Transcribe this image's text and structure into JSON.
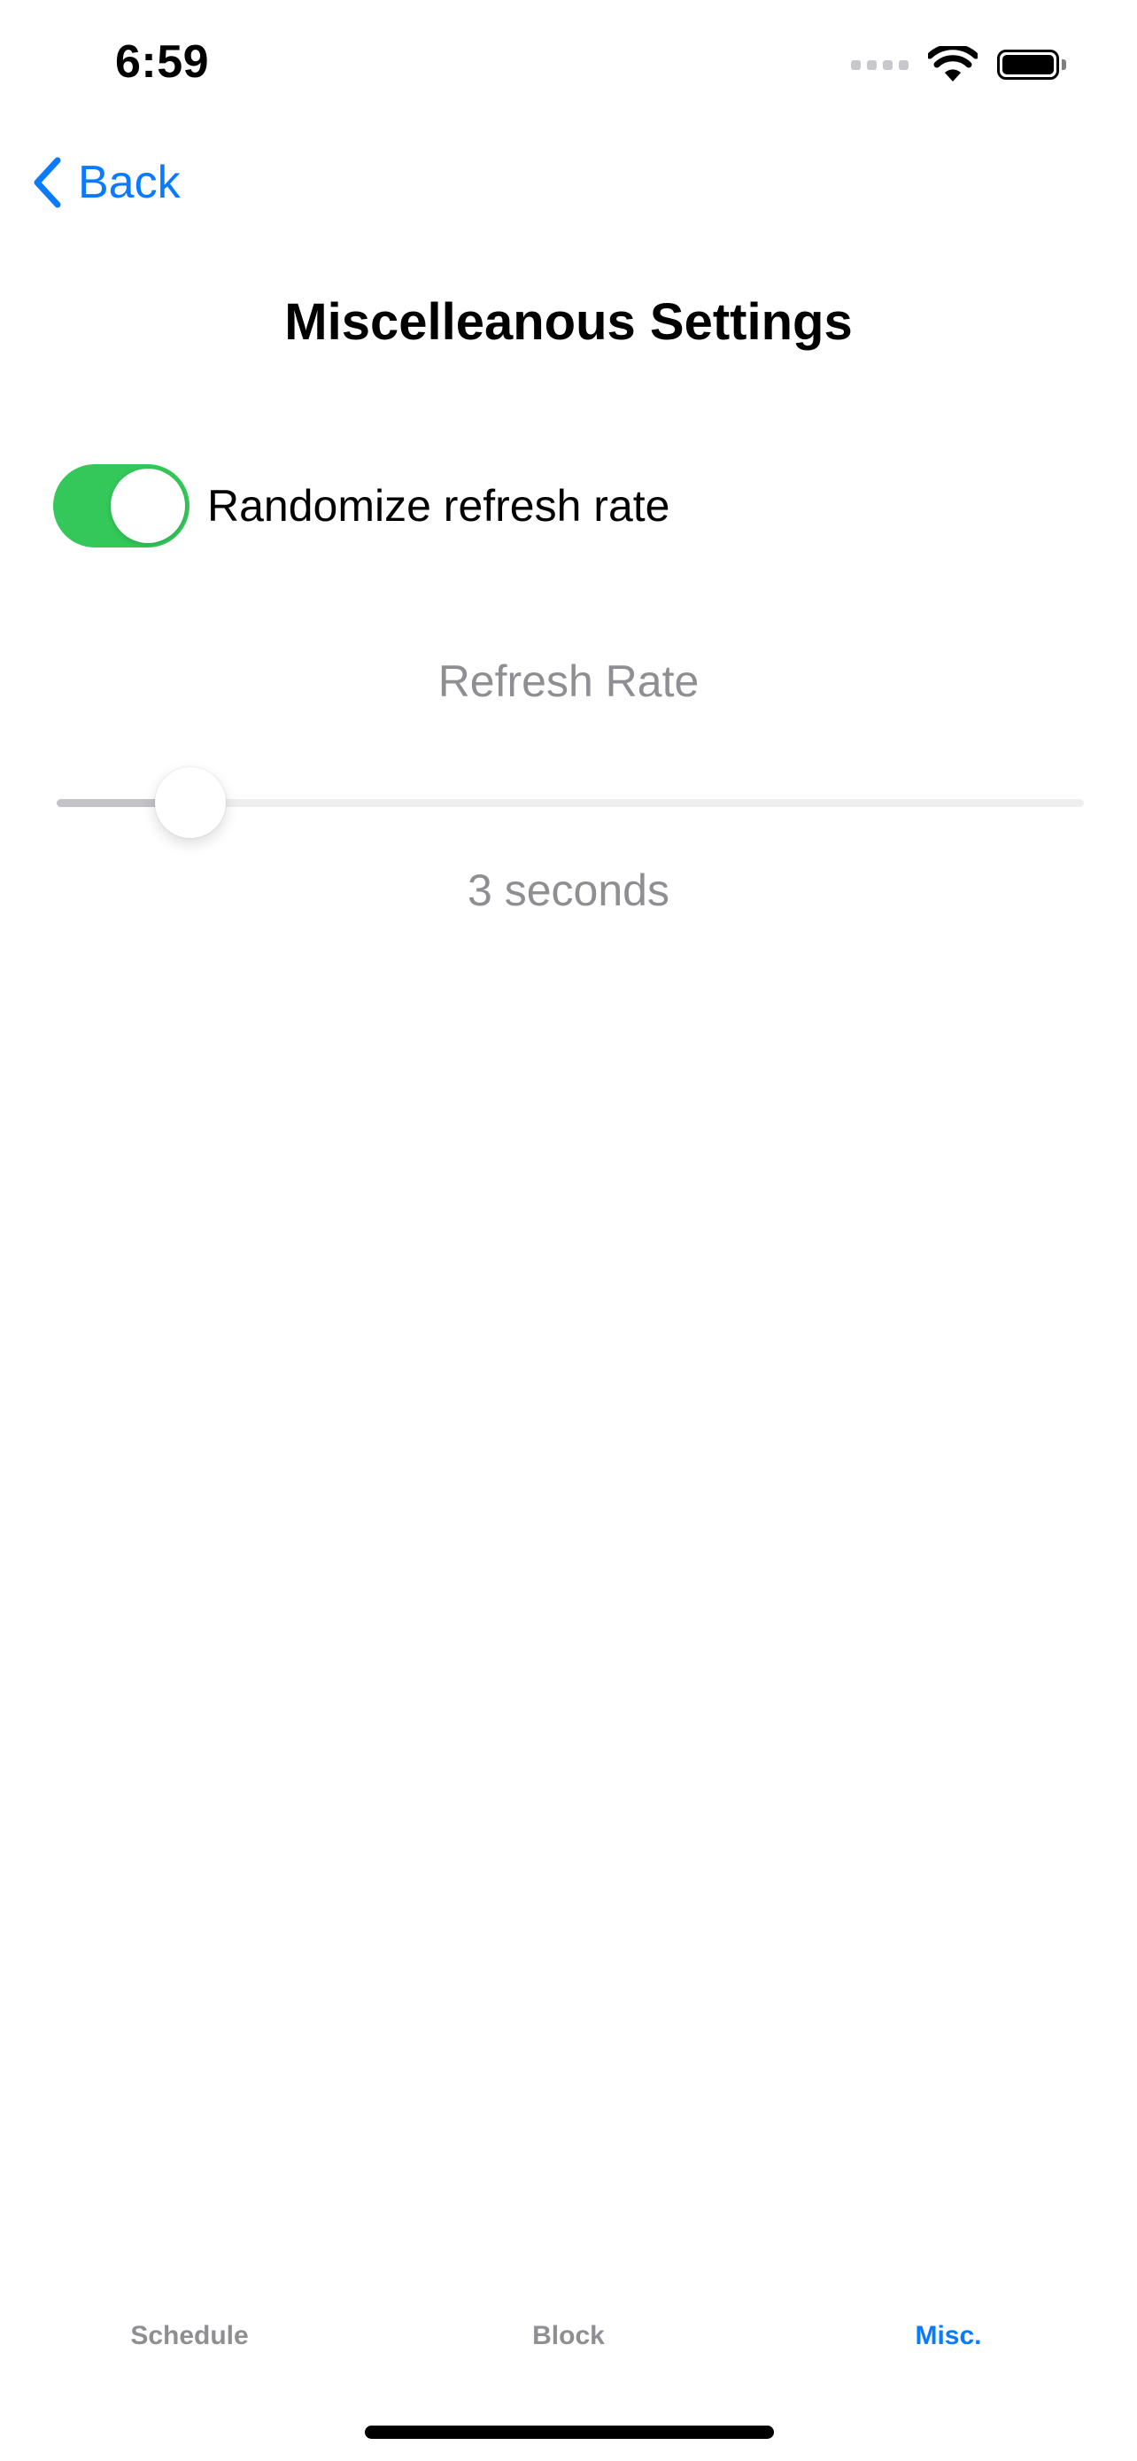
{
  "status_bar": {
    "time": "6:59",
    "signal_icon": "cellular-signal-icon",
    "wifi_icon": "wifi-icon",
    "battery_icon": "battery-full-icon",
    "battery_level": 1.0
  },
  "nav": {
    "back_label": "Back",
    "back_icon": "chevron-left-icon"
  },
  "page": {
    "title": "Miscelleanous Settings"
  },
  "settings": {
    "randomize_toggle": {
      "label": "Randomize refresh rate",
      "on": true
    },
    "refresh_rate": {
      "title": "Refresh Rate",
      "value_label": "3 seconds",
      "slider_fraction": 0.13
    }
  },
  "tab_bar": {
    "tabs": [
      {
        "label": "Schedule",
        "active": false
      },
      {
        "label": "Block",
        "active": false
      },
      {
        "label": "Misc.",
        "active": true
      }
    ]
  },
  "colors": {
    "accent": "#0a7aff",
    "toggle_on": "#34c759",
    "secondary_text": "#8e8e93"
  }
}
